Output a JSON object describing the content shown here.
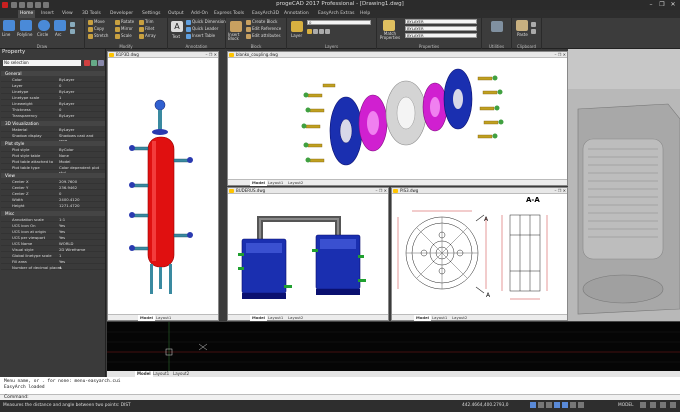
{
  "app": {
    "title": "progeCAD 2017 Professional - [Drawing1.dwg]",
    "window_controls": [
      "–",
      "❐",
      "✕"
    ]
  },
  "tabs": [
    "Home",
    "Insert",
    "View",
    "3D Tools",
    "Developer",
    "Settings",
    "Output",
    "Add-On",
    "Express Tools",
    "EasyArch3D",
    "Annotation",
    "EasyArch Extras",
    "Help"
  ],
  "active_tab": "Home",
  "ribbon": {
    "draw": {
      "label": "Draw",
      "buttons": [
        "Line",
        "Polyline",
        "Circle",
        "Arc"
      ]
    },
    "modify": {
      "label": "Modify",
      "buttons": [
        "Move",
        "Rotate",
        "Trim",
        "Copy",
        "Mirror",
        "Fillet",
        "Stretch",
        "Scale",
        "Array"
      ]
    },
    "annotation": {
      "label": "Annotation",
      "buttons": [
        "Text",
        "Quick Dimension",
        "Quick Leader",
        "Insert Table"
      ]
    },
    "block": {
      "label": "Block",
      "buttons": [
        "Insert Block",
        "Create Block",
        "Edit Reference",
        "Edit attributes"
      ]
    },
    "layers": {
      "label": "Layers",
      "layer_button": "Layer",
      "current_layer": "0"
    },
    "properties": {
      "label": "Properties",
      "match": "Match Properties",
      "color": "BYLAYER",
      "linetype": "BYLAYER",
      "lineweight": "BYLAYER"
    },
    "utilities": {
      "label": "Utilities"
    },
    "clipboard": {
      "label": "Clipboard",
      "paste": "Paste"
    }
  },
  "left_panel": {
    "title": "Property",
    "selection": "No selection",
    "sections": [
      {
        "name": "General",
        "rows": [
          {
            "k": "Color",
            "v": "ByLayer"
          },
          {
            "k": "Layer",
            "v": "0"
          },
          {
            "k": "Linetype",
            "v": "ByLayer"
          },
          {
            "k": "Linetype scale",
            "v": "1"
          },
          {
            "k": "Lineweight",
            "v": "ByLayer"
          },
          {
            "k": "Thickness",
            "v": "0"
          },
          {
            "k": "Transparency",
            "v": "ByLayer"
          }
        ]
      },
      {
        "name": "3D Visualization",
        "rows": [
          {
            "k": "Material",
            "v": "ByLayer"
          },
          {
            "k": "Shadow display",
            "v": "Shadows cast and rece..."
          }
        ]
      },
      {
        "name": "Plot style",
        "rows": [
          {
            "k": "Plot style",
            "v": "ByColor"
          },
          {
            "k": "Plot style table",
            "v": "None"
          },
          {
            "k": "Plot table attached to",
            "v": "Model"
          },
          {
            "k": "Plot table type",
            "v": "Color dependent plot styl..."
          }
        ]
      },
      {
        "name": "View",
        "rows": [
          {
            "k": "Center X",
            "v": "209.7600"
          },
          {
            "k": "Center Y",
            "v": "236.9462"
          },
          {
            "k": "Center Z",
            "v": "0"
          },
          {
            "k": "Width",
            "v": "2400.4120"
          },
          {
            "k": "Height",
            "v": "1271.4720"
          }
        ]
      },
      {
        "name": "Misc",
        "rows": [
          {
            "k": "Annotation scale",
            "v": "1:1"
          },
          {
            "k": "UCS icon On",
            "v": "Yes"
          },
          {
            "k": "UCS icon at origin",
            "v": "Yes"
          },
          {
            "k": "UCS per viewport",
            "v": "Yes"
          },
          {
            "k": "UCS Name",
            "v": "WORLD"
          },
          {
            "k": "Visual style",
            "v": "2D Wireframe"
          },
          {
            "k": "Global linetype scale",
            "v": "1"
          },
          {
            "k": "Fill area",
            "v": "Yes"
          },
          {
            "k": "Number of decimal places",
            "v": "4"
          }
        ]
      }
    ]
  },
  "windows": {
    "w1": {
      "title": "B1P3D.dwg",
      "tabs": [
        "Model",
        "Layout1"
      ]
    },
    "w2": {
      "title": "blanko_coupling.dwg",
      "tabs": [
        "Model",
        "Layout1",
        "Layout2"
      ]
    },
    "w3": {
      "title": "BUDERUS.dwg",
      "tabs": [
        "Model",
        "Layout1",
        "Layout2"
      ]
    },
    "w4": {
      "title": "PIS3.dwg",
      "tabs": [
        "Model",
        "Layout1",
        "Layout2"
      ],
      "label_aa": "A-A",
      "label_a1": "A",
      "label_a2": "A"
    }
  },
  "viewport_tabs": [
    "Model",
    "Layout1",
    "Layout2"
  ],
  "command": {
    "line1": "Menu name, or . for none: menu-easyarch.cui",
    "line2": "EasyArch loaded",
    "prompt": "Command:"
  },
  "status": {
    "message": "Measures the distance and angle between two points: DIST",
    "coords": "442.4664,400.2793,0",
    "model": "MODEL"
  },
  "colors": {
    "accent": "#2f6fd6",
    "background": "#3b3b3b",
    "vessel": "#e01010",
    "flange": "#1a2fb0",
    "magenta": "#d020d0"
  }
}
